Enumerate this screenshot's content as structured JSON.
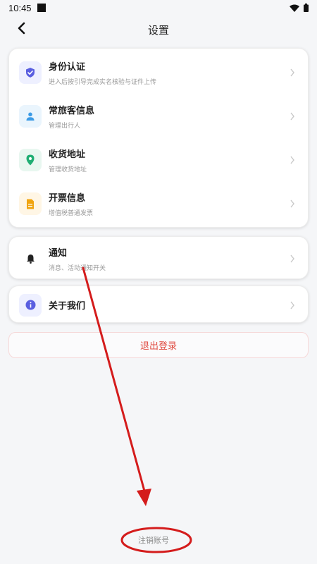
{
  "status_bar": {
    "time": "10:45"
  },
  "nav": {
    "title": "设置"
  },
  "identity_card": {
    "items": [
      {
        "label": "身份认证",
        "sub": "进入后按引导完成实名核验与证件上传",
        "icon": "shield-check-icon",
        "icon_bg": "#eef0ff",
        "icon_color": "#5a5fe0"
      },
      {
        "label": "常旅客信息",
        "sub": "管理出行人",
        "icon": "person-icon",
        "icon_bg": "#eaf5fd",
        "icon_color": "#3b9be6"
      },
      {
        "label": "收货地址",
        "sub": "管理收货地址",
        "icon": "location-pin-icon",
        "icon_bg": "#e8f7f0",
        "icon_color": "#1fae73"
      },
      {
        "label": "开票信息",
        "sub": "增值税普通发票",
        "icon": "document-icon",
        "icon_bg": "#fff6e5",
        "icon_color": "#f0a410"
      }
    ]
  },
  "notify_card": {
    "label": "通知",
    "sub": "消息、活动通知开关",
    "icon": "bell-icon"
  },
  "about_card": {
    "label": "关于我们",
    "icon": "info-icon",
    "icon_bg": "#eef0ff",
    "icon_color": "#5a5fe0"
  },
  "logout": {
    "label": "退出登录",
    "color": "#e04a3f"
  },
  "cancel_account": {
    "label": "注销账号"
  },
  "annotation": {
    "color": "#d41c1c"
  }
}
